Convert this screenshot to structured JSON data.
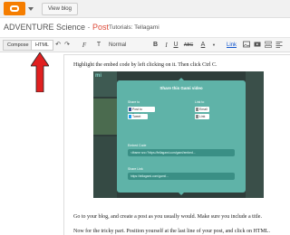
{
  "topbar": {
    "logo_icon": "blogger-logo-icon",
    "view_blog": "View blog"
  },
  "titlebar": {
    "blog_name": "ADVENTURE Science",
    "separator": " · ",
    "post_word": "Post",
    "post_title": "Tutorials: Tellagami"
  },
  "toolbar": {
    "compose": "Compose",
    "html": "HTML",
    "undo": "↶",
    "redo": "↷",
    "font_icon": "F",
    "font_size": "T",
    "format": "Normal",
    "bold": "B",
    "italic": "I",
    "underline": "U",
    "strike": "ABC",
    "text_color": "A",
    "highlight": "▼",
    "link": "Link"
  },
  "editor": {
    "p1": "Highlight the embed code by left clicking on it. Then click Ctrl C.",
    "p2": "Go to your blog, and create a post as you usually would. Make sure you include a title.",
    "p3": "Now for the tricky part. Position yourself at the last line of your post, and click on HTML."
  },
  "screenshot": {
    "corner_text": "mi",
    "modal_title": "Share this Gami video",
    "share_to_label": "Share to",
    "share_facebook": "Post to Facebook",
    "share_twitter": "Tweet",
    "link_label": "Link to",
    "link_btn_1": "Email",
    "link_btn_2": "Link",
    "embed_label": "Embed Code",
    "embed_code": "<iframe src=\"https://tellagami.com/gami/embed...",
    "share_link_label": "Share Link",
    "share_link": "https://tellagami.com/gami/...",
    "modal_color": "#5fb3a8"
  },
  "annotation": {
    "arrow_color": "#e02020",
    "arrow_icon": "red-arrow-icon"
  }
}
